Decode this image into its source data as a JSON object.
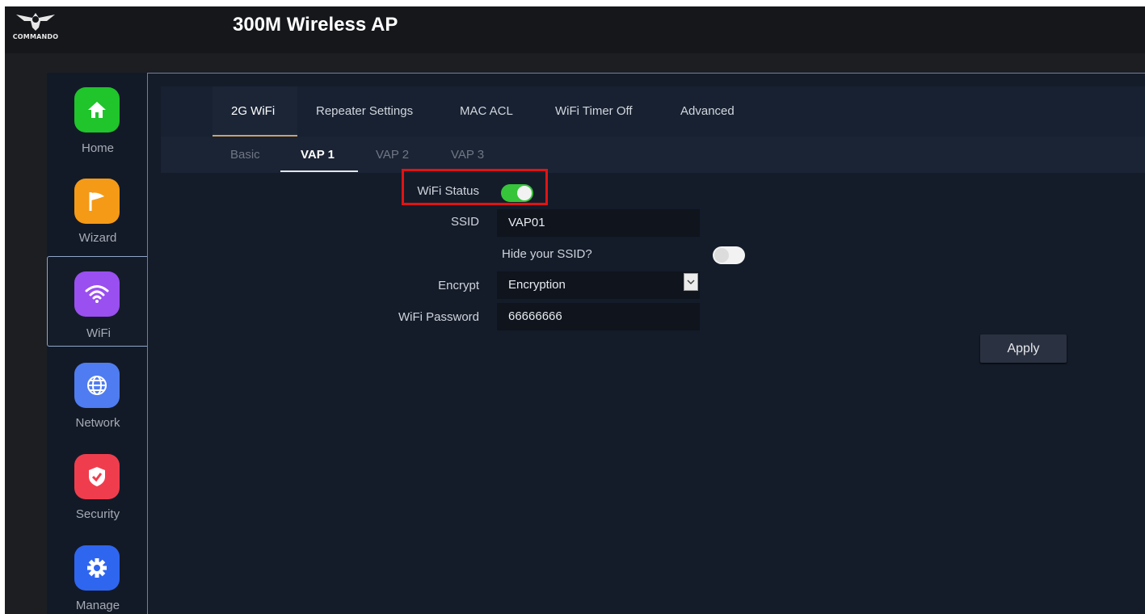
{
  "header": {
    "logo_text": "COMMANDO",
    "title": "300M Wireless AP"
  },
  "sidebar": {
    "items": [
      {
        "label": "Home",
        "icon": "home-icon",
        "color": "#20c42b"
      },
      {
        "label": "Wizard",
        "icon": "flag-icon",
        "color": "#f59a16"
      },
      {
        "label": "WiFi",
        "icon": "wifi-icon",
        "color": "#9a4ff0"
      },
      {
        "label": "Network",
        "icon": "globe-icon",
        "color": "#4f7cf0"
      },
      {
        "label": "Security",
        "icon": "shield-icon",
        "color": "#f03d4d"
      },
      {
        "label": "Manage",
        "icon": "gear-icon",
        "color": "#2f66f0"
      }
    ],
    "active": "WiFi"
  },
  "tabs": [
    "2G WiFi",
    "Repeater Settings",
    "MAC ACL",
    "WiFi Timer Off",
    "Advanced"
  ],
  "active_tab": "2G WiFi",
  "subtabs": [
    "Basic",
    "VAP 1",
    "VAP 2",
    "VAP 3"
  ],
  "active_subtab": "VAP 1",
  "form": {
    "wifi_status_label": "WiFi Status",
    "wifi_status_on": true,
    "ssid_label": "SSID",
    "ssid_value": "VAP01",
    "hide_ssid_label": "Hide your SSID?",
    "hide_ssid_on": false,
    "encrypt_label": "Encrypt",
    "encrypt_value": "Encryption",
    "password_label": "WiFi Password",
    "password_value": "66666666",
    "apply_label": "Apply"
  },
  "colors": {
    "toggle_on": "#36c43a",
    "highlight": "#e01414",
    "tab_accent": "#c9a36a"
  }
}
